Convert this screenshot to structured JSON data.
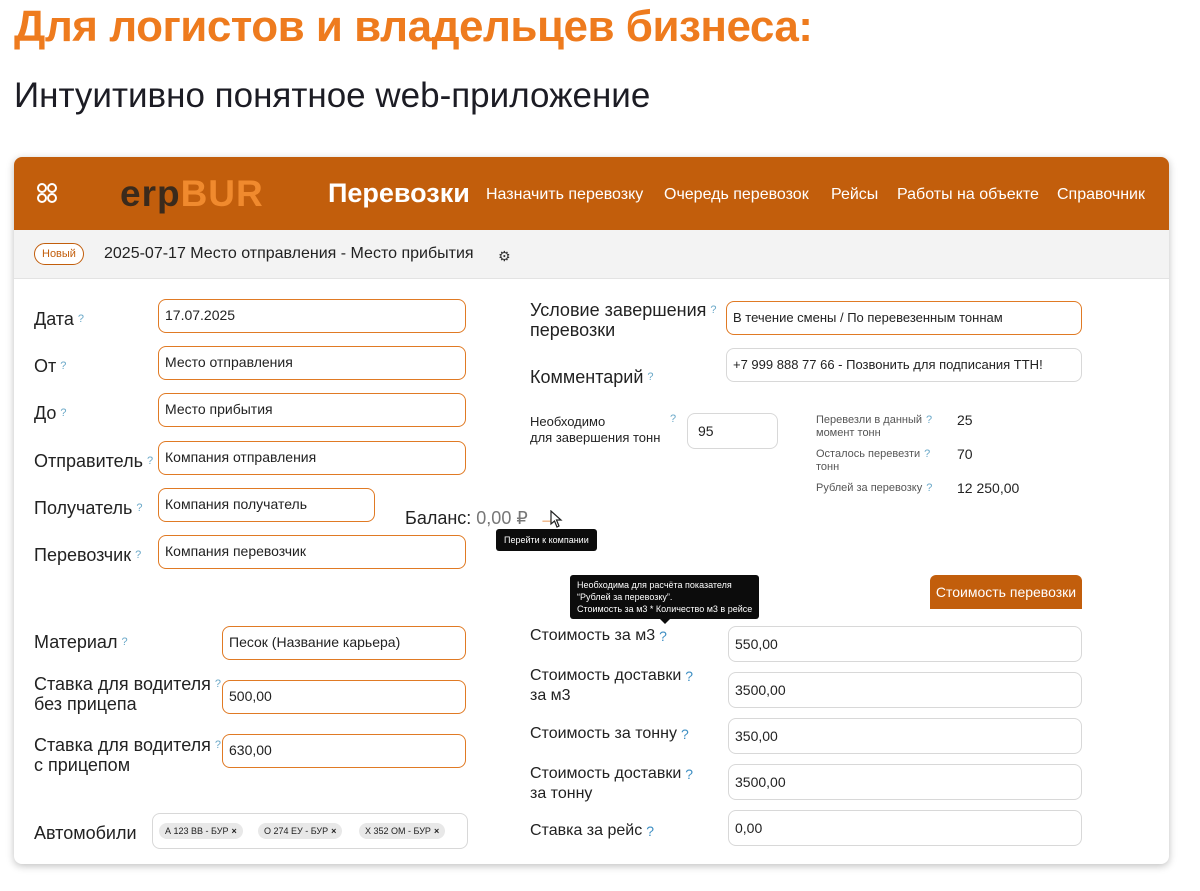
{
  "heading": "Для логистов и владельцев бизнеса:",
  "subheading": "Интуитивно понятное web-приложение",
  "app": {
    "brand_dark": "erp",
    "brand_accent": "BUR",
    "section_title": "Перевозки",
    "nav": [
      "Назначить перевозку",
      "Очередь перевозок",
      "Рейсы",
      "Работы на объекте",
      "Справочник"
    ],
    "status_badge": "Новый",
    "doc_title": "2025-07-17 Место отправления - Место прибытия"
  },
  "form_left": {
    "date": {
      "label": "Дата",
      "value": "17.07.2025"
    },
    "from": {
      "label": "От",
      "value": "Место отправления"
    },
    "to": {
      "label": "До",
      "value": "Место прибытия"
    },
    "sender": {
      "label": "Отправитель",
      "value": "Компания отправления"
    },
    "receiver": {
      "label": "Получатель",
      "value": "Компания получатель"
    },
    "carrier": {
      "label": "Перевозчик",
      "value": "Компания перевозчик"
    },
    "balance_label": "Баланс:",
    "balance_value": "0,00 ₽",
    "balance_tooltip": "Перейти к компании",
    "material": {
      "label": "Материал",
      "value": "Песок (Название карьера)"
    },
    "rate_no_trailer": {
      "label_line1": "Ставка для водителя",
      "label_line2": "без прицепа",
      "value": "500,00"
    },
    "rate_trailer": {
      "label_line1": "Ставка для водителя",
      "label_line2": "с прицепом",
      "value": "630,00"
    },
    "vehicles": {
      "label": "Автомобили",
      "chips": [
        "А 123 ВВ - БУР",
        "О 274 ЕУ - БУР",
        "Х 352 ОМ - БУР"
      ]
    }
  },
  "form_right": {
    "completion": {
      "label_line1": "Условие завершения",
      "label_line2": "перевозки",
      "value": "В течение смены / По перевезенным тоннам"
    },
    "comment": {
      "label": "Комментарий",
      "value": "+7 999 888 77 66 - Позвонить для подписания ТТН!"
    },
    "tons_needed": {
      "label_line1": "Необходимо",
      "label_line2": "для завершения тонн",
      "value": "95"
    },
    "stats": [
      {
        "label_line1": "Перевезли в данный",
        "label_line2": "момент тонн",
        "value": "25"
      },
      {
        "label_line1": "Осталось перевезти",
        "label_line2": "тонн",
        "value": "70"
      },
      {
        "label_line1": "Рублей за перевозку",
        "label_line2": "",
        "value": "12 250,00"
      }
    ],
    "cost_tooltip": [
      "Необходима для расчёта показателя",
      "“Рублей за перевозку”.",
      "Стоимость за м3 * Количество м3 в рейсе"
    ],
    "cost_button": "Стоимость перевозки",
    "cost_m3": {
      "label": "Стоимость за м3",
      "value": "550,00"
    },
    "delivery_m3": {
      "label_line1": "Стоимость доставки",
      "label_line2": "за м3",
      "value": "3500,00"
    },
    "cost_ton": {
      "label": "Стоимость за тонну",
      "value": "350,00"
    },
    "delivery_ton": {
      "label_line1": "Стоимость доставки",
      "label_line2": "за тонну",
      "value": "3500,00"
    },
    "trip_rate": {
      "label": "Ставка за рейс",
      "value": "0,00"
    }
  },
  "help_mark": "?",
  "colors": {
    "accent": "#ee7b1e",
    "navbar": "#c25e0c",
    "brand_accent": "#f08a2e"
  },
  "icons": [
    "app-grid-icon",
    "gear-icon",
    "arrow-right-icon",
    "cursor-icon",
    "close-icon"
  ]
}
